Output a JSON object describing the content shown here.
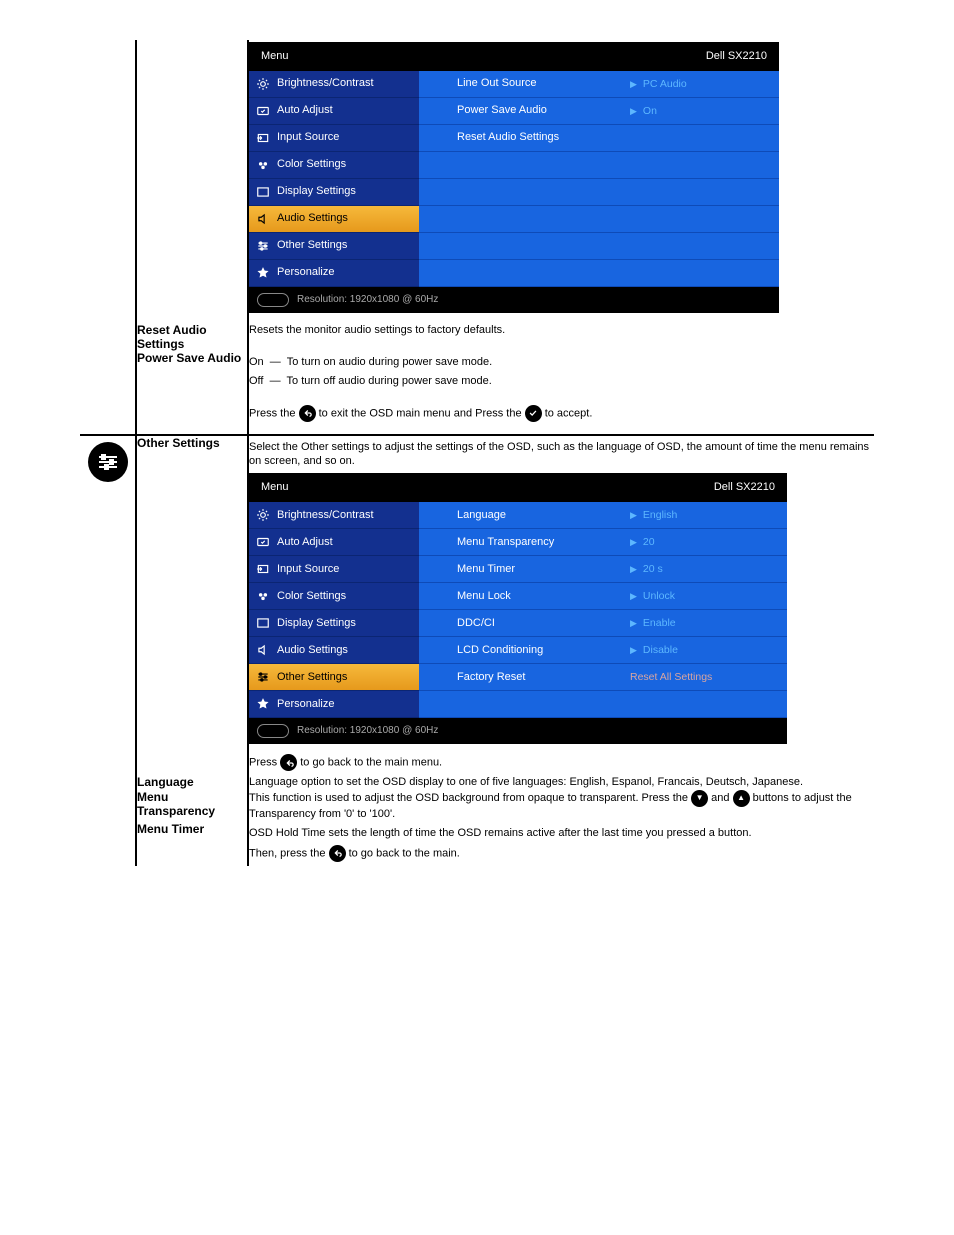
{
  "osd1": {
    "menu_label": "Menu",
    "model": "Dell SX2210",
    "side": [
      "Brightness/Contrast",
      "Auto Adjust",
      "Input Source",
      "Color Settings",
      "Display Settings",
      "Audio Settings",
      "Other Settings",
      "Personalize"
    ],
    "rows": [
      {
        "opt": "Line Out Source",
        "val": "PC Audio"
      },
      {
        "opt": "Power Save Audio",
        "val": "On"
      },
      {
        "opt": "Reset Audio Settings",
        "val": ""
      }
    ],
    "resolution": "Resolution: 1920x1080 @ 60Hz",
    "selected_index": 5
  },
  "desc_r1": {
    "title": "Reset Audio Settings",
    "text": "Resets the monitor audio settings to factory defaults."
  },
  "desc_power": {
    "title": "Power Save Audio",
    "line1": "To turn on audio during power save mode.",
    "line2": "To turn off audio during power save mode.",
    "on": "On",
    "off": "Off"
  },
  "desc_back_row": {
    "pre": "Press the ",
    "mid": " to exit the OSD main menu and Press the ",
    "post": " to accept."
  },
  "section2": {
    "label": "Other Settings",
    "intro": "Select the Other settings to adjust the settings of the OSD, such as the language of OSD, the amount of time the menu remains on screen, and so on."
  },
  "osd2": {
    "menu_label": "Menu",
    "model": "Dell SX2210",
    "side": [
      "Brightness/Contrast",
      "Auto Adjust",
      "Input Source",
      "Color Settings",
      "Display Settings",
      "Audio Settings",
      "Other Settings",
      "Personalize"
    ],
    "rows": [
      {
        "opt": "Language",
        "val": "English"
      },
      {
        "opt": "Menu Transparency",
        "val": "20"
      },
      {
        "opt": "Menu Timer",
        "val": "20 s"
      },
      {
        "opt": "Menu Lock",
        "val": "Unlock"
      },
      {
        "opt": "DDC/CI",
        "val": "Enable"
      },
      {
        "opt": "LCD Conditioning",
        "val": "Disable"
      },
      {
        "opt": "Factory Reset",
        "val": "Reset All Settings"
      }
    ],
    "resolution": "Resolution: 1920x1080 @ 60Hz",
    "selected_index": 6
  },
  "desc_back2": {
    "pre": "Press ",
    "post": " to go back to the main menu."
  },
  "desc_lang": {
    "title": "Language",
    "text": "Language option to set the OSD display to one of five languages: English, Espanol, Francais, Deutsch, Japanese."
  },
  "desc_trans": {
    "title": "Menu Transparency",
    "pre": "This function is used to adjust the OSD background from opaque to transparent. Press the ",
    "mid": " and ",
    "post": " buttons to adjust the Transparency from '0' to '100'."
  },
  "desc_timer": {
    "title": "Menu Timer",
    "pre": "OSD Hold Time sets the length of time the OSD remains active after the last time you pressed a button.",
    "then": "Then, press the ",
    "mid": " to go back to the main."
  }
}
